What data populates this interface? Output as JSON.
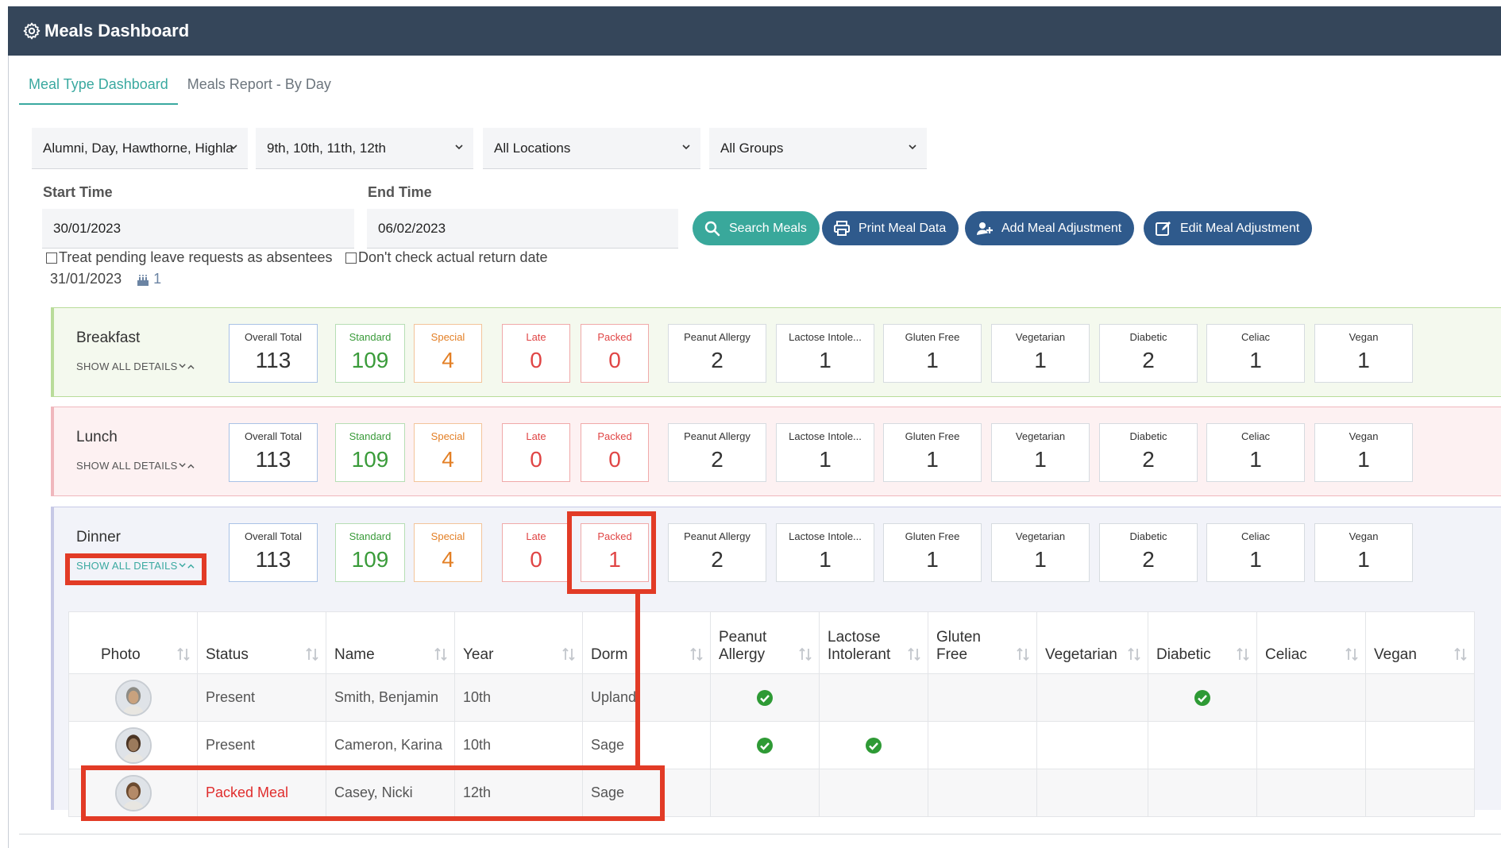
{
  "app": {
    "title": "Meals Dashboard"
  },
  "tabs": [
    {
      "label": "Meal Type Dashboard"
    },
    {
      "label": "Meals Report - By Day"
    }
  ],
  "filters": {
    "houses": "Alumni, Day, Hawthorne, Highlar",
    "years": "9th, 10th, 11th, 12th",
    "locations": "All Locations",
    "groups": "All Groups"
  },
  "times": {
    "start_label": "Start Time",
    "start_value": "30/01/2023",
    "end_label": "End Time",
    "end_value": "06/02/2023"
  },
  "buttons": {
    "search": "Search Meals",
    "print": "Print Meal Data",
    "add_adj": "Add Meal Adjustment",
    "edit_adj": "Edit Meal Adjustment"
  },
  "checkboxes": {
    "pending": "Treat pending leave requests as absentees",
    "return": "Don't check actual return date"
  },
  "day": {
    "date": "31/01/2023",
    "count": "1"
  },
  "card_labels": [
    "Overall Total",
    "Standard",
    "Special",
    "Late",
    "Packed",
    "Peanut Allergy",
    "Lactose Intole...",
    "Gluten Free",
    "Vegetarian",
    "Diabetic",
    "Celiac",
    "Vegan"
  ],
  "show_all": "SHOW ALL DETAILS",
  "meals": [
    {
      "name": "Breakfast",
      "values": [
        "113",
        "109",
        "4",
        "0",
        "0",
        "2",
        "1",
        "1",
        "1",
        "2",
        "1",
        "1"
      ]
    },
    {
      "name": "Lunch",
      "values": [
        "113",
        "109",
        "4",
        "0",
        "0",
        "2",
        "1",
        "1",
        "1",
        "2",
        "1",
        "1"
      ]
    },
    {
      "name": "Dinner",
      "values": [
        "113",
        "109",
        "4",
        "0",
        "1",
        "2",
        "1",
        "1",
        "1",
        "2",
        "1",
        "1"
      ]
    }
  ],
  "table": {
    "headers": [
      "Photo",
      "Status",
      "Name",
      "Year",
      "Dorm",
      "Peanut Allergy",
      "Lactose Intolerant",
      "Gluten Free",
      "Vegetarian",
      "Diabetic",
      "Celiac",
      "Vegan"
    ],
    "rows": [
      {
        "status": "Present",
        "name": "Smith, Benjamin",
        "year": "10th",
        "dorm": "Upland"
      },
      {
        "status": "Present",
        "name": "Cameron, Karina",
        "year": "10th",
        "dorm": "Sage"
      },
      {
        "status": "Packed Meal",
        "name": "Casey, Nicki",
        "year": "12th",
        "dorm": "Sage"
      }
    ]
  },
  "colors": {
    "header_bg": "#35465a",
    "accent_teal": "#3aa9a0",
    "button_navy": "#2f5a8c",
    "highlight": "#e23b26"
  }
}
